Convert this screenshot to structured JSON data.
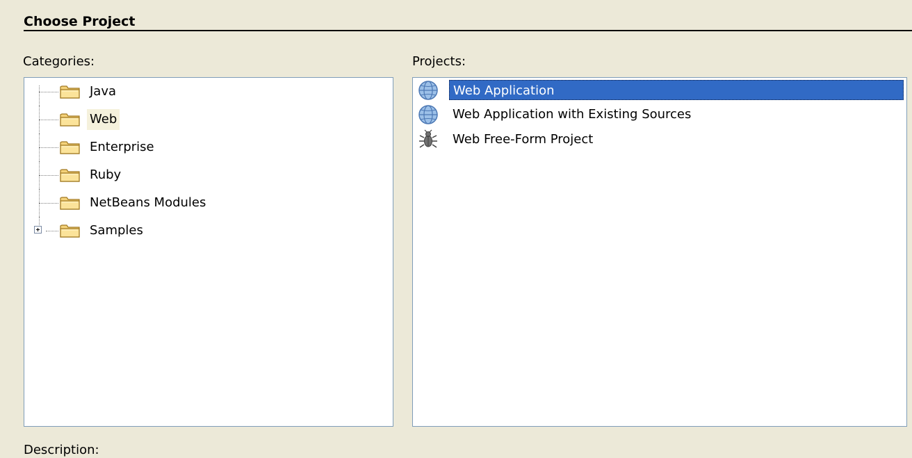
{
  "section": {
    "title": "Choose Project"
  },
  "categories": {
    "label": "Categories:",
    "items": [
      {
        "label": "Java",
        "icon": "folder-icon",
        "expandable": false,
        "selected": false
      },
      {
        "label": "Web",
        "icon": "folder-icon",
        "expandable": false,
        "selected": true
      },
      {
        "label": "Enterprise",
        "icon": "folder-icon",
        "expandable": false,
        "selected": false
      },
      {
        "label": "Ruby",
        "icon": "folder-icon",
        "expandable": false,
        "selected": false
      },
      {
        "label": "NetBeans Modules",
        "icon": "folder-icon",
        "expandable": false,
        "selected": false
      },
      {
        "label": "Samples",
        "icon": "folder-icon",
        "expandable": true,
        "selected": false
      }
    ]
  },
  "projects": {
    "label": "Projects:",
    "items": [
      {
        "label": "Web Application",
        "icon": "globe-icon",
        "selected": true
      },
      {
        "label": "Web Application with Existing Sources",
        "icon": "globe-icon",
        "selected": false
      },
      {
        "label": "Web Free-Form Project",
        "icon": "bug-icon",
        "selected": false
      }
    ]
  },
  "description": {
    "label": "Description:"
  },
  "colors": {
    "background": "#ece9d8",
    "panel_border": "#7f9db9",
    "selection": "#316ac5",
    "category_highlight": "#f5f1dc"
  }
}
